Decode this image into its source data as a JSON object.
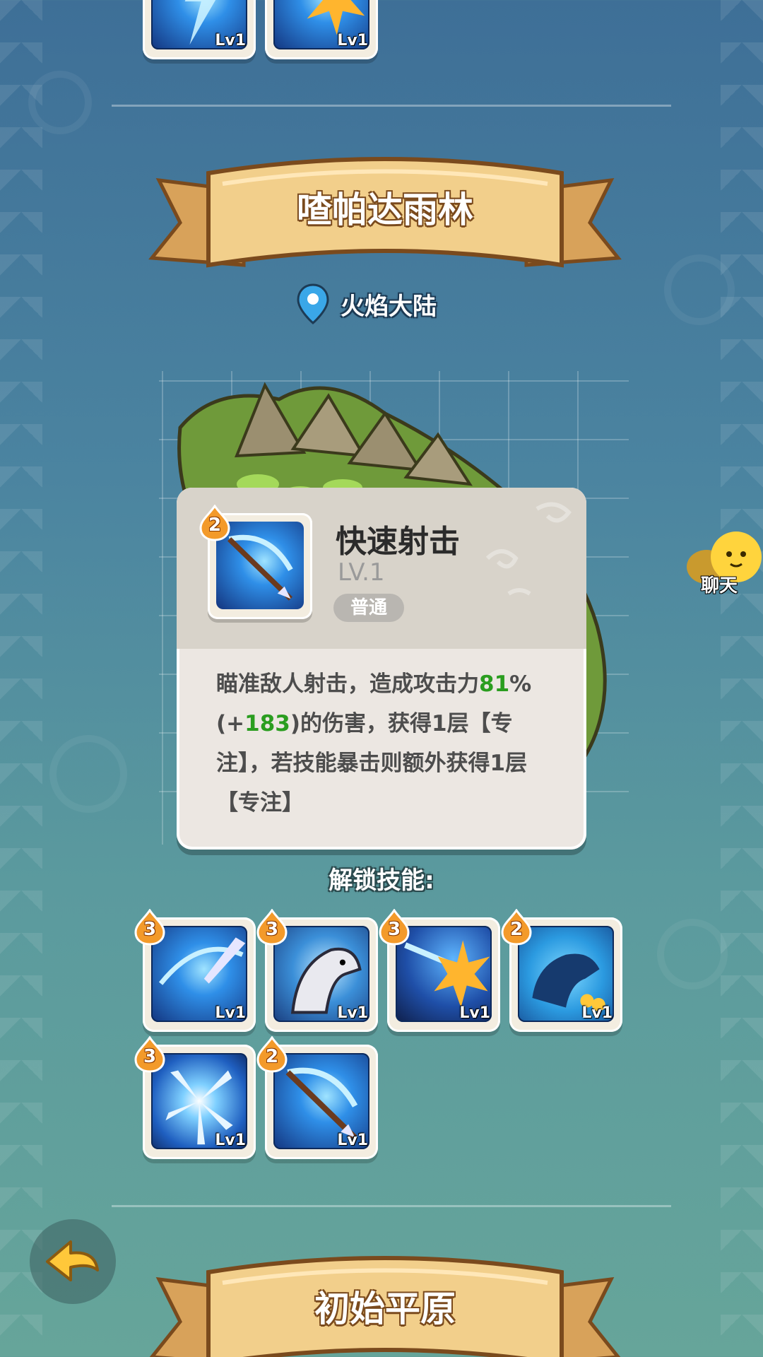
{
  "previous_section": {
    "skills": [
      {
        "level_label": "Lv1"
      },
      {
        "level_label": "Lv1"
      }
    ]
  },
  "region": {
    "title": "喳帕达雨林",
    "location": "火焰大陆"
  },
  "tooltip": {
    "skill_name": "快速射击",
    "skill_level": "LV.1",
    "quality": "普通",
    "rank": "2",
    "description_parts": {
      "p1": "瞄准敌人射击，造成攻击力",
      "v1": "81",
      "p2": "%(+",
      "v2": "183",
      "p3": ")的伤害，获得1层【专注】，若技能暴击则额外获得1层【专注】"
    }
  },
  "unlock": {
    "label": "解锁技能:",
    "skills": [
      {
        "rank": "3",
        "level_label": "Lv1",
        "icon": "arrow-swirl-icon"
      },
      {
        "rank": "3",
        "level_label": "Lv1",
        "icon": "eagle-icon"
      },
      {
        "rank": "3",
        "level_label": "Lv1",
        "icon": "burst-strike-icon"
      },
      {
        "rank": "2",
        "level_label": "Lv1",
        "icon": "horse-coin-icon"
      },
      {
        "rank": "3",
        "level_label": "Lv1",
        "icon": "shard-burst-icon"
      },
      {
        "rank": "2",
        "level_label": "Lv1",
        "icon": "bow-arrow-icon"
      }
    ]
  },
  "next_region": {
    "title": "初始平原"
  },
  "chat": {
    "label": "聊天"
  },
  "colors": {
    "highlight_green": "#2a9d1f",
    "banner_gold": "#f2cf8b",
    "rank_orange": "#f39a2a"
  }
}
